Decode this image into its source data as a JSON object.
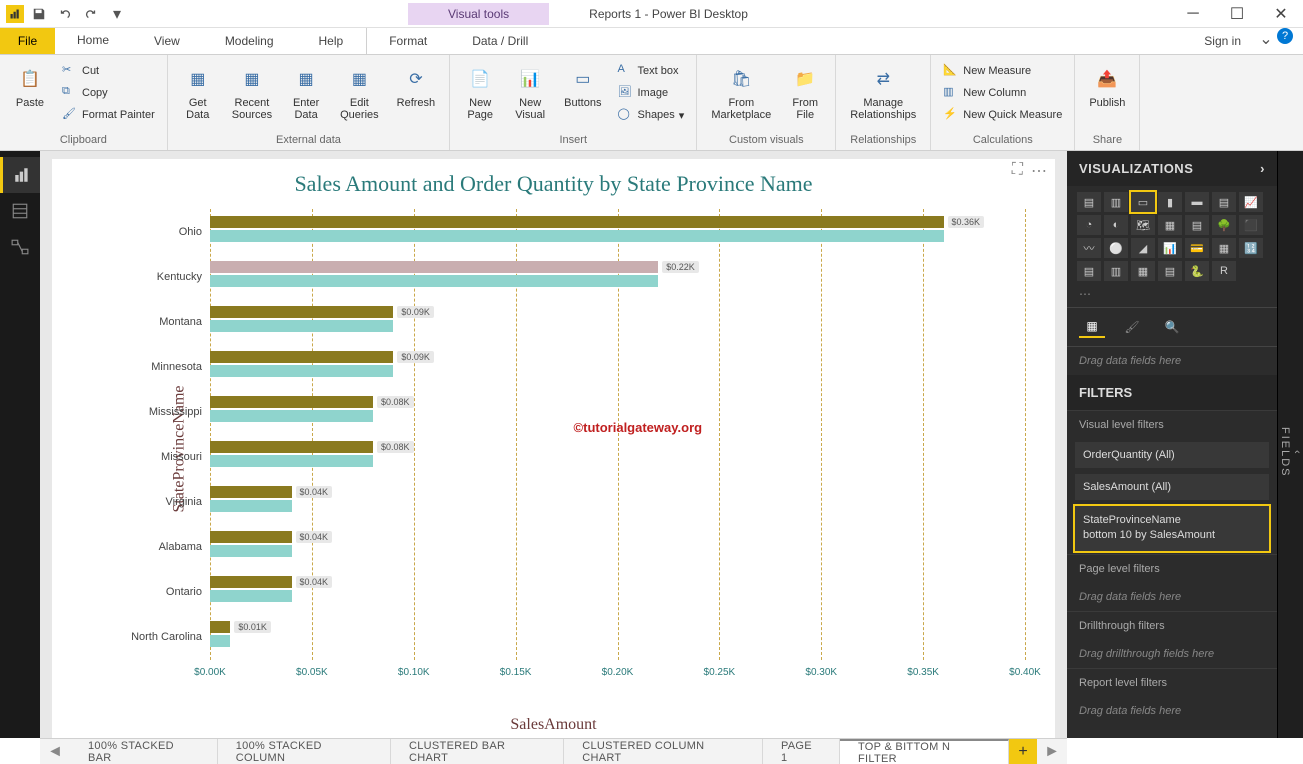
{
  "window": {
    "title": "Reports 1 - Power BI Desktop",
    "visual_tools": "Visual tools"
  },
  "tabs": {
    "file": "File",
    "items": [
      "Home",
      "View",
      "Modeling",
      "Help",
      "Format",
      "Data / Drill"
    ],
    "signin": "Sign in"
  },
  "ribbon": {
    "clipboard": {
      "label": "Clipboard",
      "paste": "Paste",
      "cut": "Cut",
      "copy": "Copy",
      "fmt": "Format Painter"
    },
    "external": {
      "label": "External data",
      "get": "Get\nData",
      "recent": "Recent\nSources",
      "enter": "Enter\nData",
      "edit": "Edit\nQueries",
      "refresh": "Refresh"
    },
    "insert": {
      "label": "Insert",
      "newpage": "New\nPage",
      "newvisual": "New\nVisual",
      "buttons": "Buttons",
      "textbox": "Text box",
      "image": "Image",
      "shapes": "Shapes"
    },
    "custom": {
      "label": "Custom visuals",
      "market": "From\nMarketplace",
      "file": "From\nFile"
    },
    "rel": {
      "label": "Relationships",
      "manage": "Manage\nRelationships"
    },
    "calc": {
      "label": "Calculations",
      "measure": "New Measure",
      "column": "New Column",
      "quick": "New Quick Measure"
    },
    "share": {
      "label": "Share",
      "publish": "Publish"
    }
  },
  "chart_data": {
    "type": "bar",
    "title": "Sales Amount and Order Quantity by State Province Name",
    "xlabel": "SalesAmount",
    "ylabel": "StateProvinceName",
    "xlim": [
      0,
      0.4
    ],
    "xticks": [
      "$0.00K",
      "$0.05K",
      "$0.10K",
      "$0.15K",
      "$0.20K",
      "$0.25K",
      "$0.30K",
      "$0.35K",
      "$0.40K"
    ],
    "categories": [
      "Ohio",
      "Kentucky",
      "Montana",
      "Minnesota",
      "Mississippi",
      "Missouri",
      "Virginia",
      "Alabama",
      "Ontario",
      "North Carolina"
    ],
    "series": [
      {
        "name": "SalesAmount",
        "color": "#8a7a1f",
        "values": [
          0.36,
          0.22,
          0.09,
          0.09,
          0.08,
          0.08,
          0.04,
          0.04,
          0.04,
          0.01
        ]
      },
      {
        "name": "OrderQuantity",
        "color": "#8fd4cd",
        "values": [
          0.36,
          0.22,
          0.09,
          0.09,
          0.08,
          0.08,
          0.04,
          0.04,
          0.04,
          0.01
        ]
      }
    ],
    "data_labels": [
      "$0.36K",
      "$0.22K",
      "$0.09K",
      "$0.09K",
      "$0.08K",
      "$0.08K",
      "$0.04K",
      "$0.04K",
      "$0.04K",
      "$0.01K"
    ],
    "watermark": "©tutorialgateway.org"
  },
  "viz": {
    "header": "VISUALIZATIONS",
    "drop": "Drag data fields here",
    "filters_hdr": "FILTERS",
    "visual_level": "Visual level filters",
    "f1": "OrderQuantity  (All)",
    "f2": "SalesAmount  (All)",
    "f3a": "StateProvinceName",
    "f3b": "bottom 10 by SalesAmount",
    "page_level": "Page level filters",
    "page_drop": "Drag data fields here",
    "drill": "Drillthrough filters",
    "drill_drop": "Drag drillthrough fields here",
    "report_level": "Report level filters",
    "report_drop": "Drag data fields here",
    "fields_tab": "FIELDS"
  },
  "pages": {
    "items": [
      "100% Stacked Bar",
      "100% Stacked Column",
      "Clustered Bar Chart",
      "Clustered Column Chart",
      "Page 1",
      "TOP & Bittom N Filter"
    ],
    "active": 5
  },
  "colors": {
    "special_row": "#c9aeb0"
  }
}
